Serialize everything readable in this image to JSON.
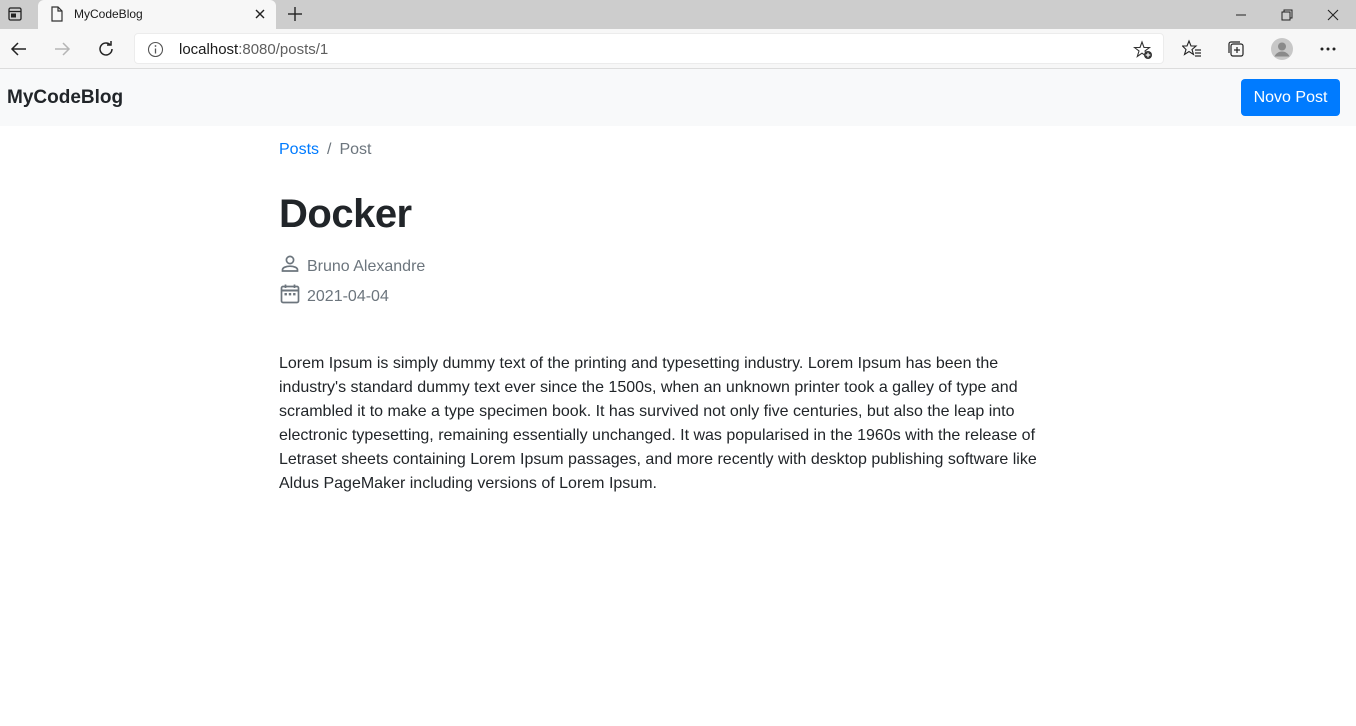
{
  "browser": {
    "tab_title": "MyCodeBlog",
    "url_host": "localhost",
    "url_rest": ":8080/posts/1"
  },
  "navbar": {
    "brand": "MyCodeBlog",
    "new_post_label": "Novo Post"
  },
  "breadcrumb": {
    "items": [
      "Posts",
      "Post"
    ],
    "separator": "/"
  },
  "post": {
    "title": "Docker",
    "author": "Bruno Alexandre",
    "date": "2021-04-04",
    "body": "Lorem Ipsum is simply dummy text of the printing and typesetting industry. Lorem Ipsum has been the industry's standard dummy text ever since the 1500s, when an unknown printer took a galley of type and scrambled it to make a type specimen book. It has survived not only five centuries, but also the leap into electronic typesetting, remaining essentially unchanged. It was popularised in the 1960s with the release of Letraset sheets containing Lorem Ipsum passages, and more recently with desktop publishing software like Aldus PageMaker including versions of Lorem Ipsum."
  },
  "colors": {
    "primary": "#007bff",
    "navbar_bg": "#f8f9fa",
    "muted_text": "#6c757d",
    "body_text": "#212529"
  },
  "icons": {
    "author": "person-icon",
    "date": "calendar-icon"
  }
}
